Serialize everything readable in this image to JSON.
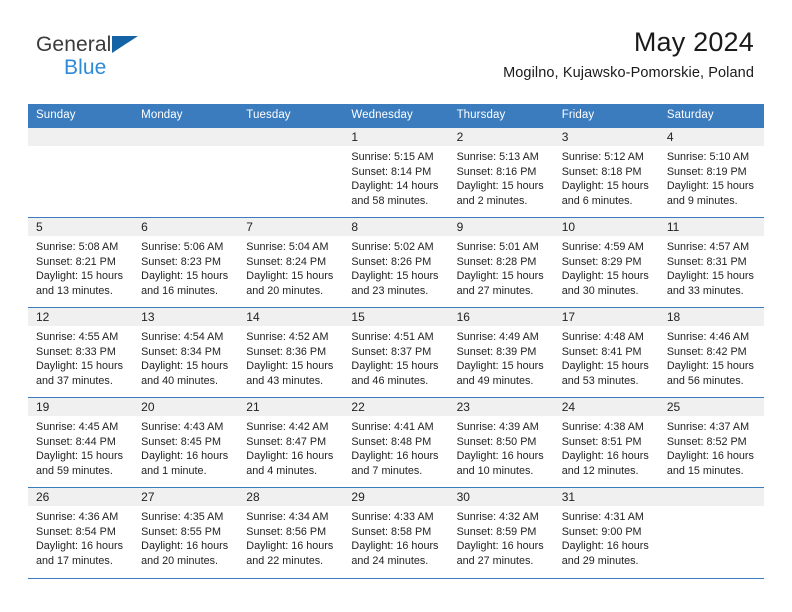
{
  "brand": {
    "name_line1": "General",
    "name_line2": "Blue",
    "accent_color": "#2e8ad8",
    "logo_mark_color": "#1464a5"
  },
  "header": {
    "month_title": "May 2024",
    "location": "Mogilno, Kujawsko-Pomorskie, Poland"
  },
  "calendar": {
    "header_bg": "#3a7cbe",
    "header_text_color": "#ffffff",
    "daynum_band_bg": "#f0f0f0",
    "weekday_headers": [
      "Sunday",
      "Monday",
      "Tuesday",
      "Wednesday",
      "Thursday",
      "Friday",
      "Saturday"
    ],
    "weeks": [
      [
        {
          "day": "",
          "empty": true
        },
        {
          "day": "",
          "empty": true
        },
        {
          "day": "",
          "empty": true
        },
        {
          "day": "1",
          "sunrise": "Sunrise: 5:15 AM",
          "sunset": "Sunset: 8:14 PM",
          "daylight_line1": "Daylight: 14 hours",
          "daylight_line2": "and 58 minutes."
        },
        {
          "day": "2",
          "sunrise": "Sunrise: 5:13 AM",
          "sunset": "Sunset: 8:16 PM",
          "daylight_line1": "Daylight: 15 hours",
          "daylight_line2": "and 2 minutes."
        },
        {
          "day": "3",
          "sunrise": "Sunrise: 5:12 AM",
          "sunset": "Sunset: 8:18 PM",
          "daylight_line1": "Daylight: 15 hours",
          "daylight_line2": "and 6 minutes."
        },
        {
          "day": "4",
          "sunrise": "Sunrise: 5:10 AM",
          "sunset": "Sunset: 8:19 PM",
          "daylight_line1": "Daylight: 15 hours",
          "daylight_line2": "and 9 minutes."
        }
      ],
      [
        {
          "day": "5",
          "sunrise": "Sunrise: 5:08 AM",
          "sunset": "Sunset: 8:21 PM",
          "daylight_line1": "Daylight: 15 hours",
          "daylight_line2": "and 13 minutes."
        },
        {
          "day": "6",
          "sunrise": "Sunrise: 5:06 AM",
          "sunset": "Sunset: 8:23 PM",
          "daylight_line1": "Daylight: 15 hours",
          "daylight_line2": "and 16 minutes."
        },
        {
          "day": "7",
          "sunrise": "Sunrise: 5:04 AM",
          "sunset": "Sunset: 8:24 PM",
          "daylight_line1": "Daylight: 15 hours",
          "daylight_line2": "and 20 minutes."
        },
        {
          "day": "8",
          "sunrise": "Sunrise: 5:02 AM",
          "sunset": "Sunset: 8:26 PM",
          "daylight_line1": "Daylight: 15 hours",
          "daylight_line2": "and 23 minutes."
        },
        {
          "day": "9",
          "sunrise": "Sunrise: 5:01 AM",
          "sunset": "Sunset: 8:28 PM",
          "daylight_line1": "Daylight: 15 hours",
          "daylight_line2": "and 27 minutes."
        },
        {
          "day": "10",
          "sunrise": "Sunrise: 4:59 AM",
          "sunset": "Sunset: 8:29 PM",
          "daylight_line1": "Daylight: 15 hours",
          "daylight_line2": "and 30 minutes."
        },
        {
          "day": "11",
          "sunrise": "Sunrise: 4:57 AM",
          "sunset": "Sunset: 8:31 PM",
          "daylight_line1": "Daylight: 15 hours",
          "daylight_line2": "and 33 minutes."
        }
      ],
      [
        {
          "day": "12",
          "sunrise": "Sunrise: 4:55 AM",
          "sunset": "Sunset: 8:33 PM",
          "daylight_line1": "Daylight: 15 hours",
          "daylight_line2": "and 37 minutes."
        },
        {
          "day": "13",
          "sunrise": "Sunrise: 4:54 AM",
          "sunset": "Sunset: 8:34 PM",
          "daylight_line1": "Daylight: 15 hours",
          "daylight_line2": "and 40 minutes."
        },
        {
          "day": "14",
          "sunrise": "Sunrise: 4:52 AM",
          "sunset": "Sunset: 8:36 PM",
          "daylight_line1": "Daylight: 15 hours",
          "daylight_line2": "and 43 minutes."
        },
        {
          "day": "15",
          "sunrise": "Sunrise: 4:51 AM",
          "sunset": "Sunset: 8:37 PM",
          "daylight_line1": "Daylight: 15 hours",
          "daylight_line2": "and 46 minutes."
        },
        {
          "day": "16",
          "sunrise": "Sunrise: 4:49 AM",
          "sunset": "Sunset: 8:39 PM",
          "daylight_line1": "Daylight: 15 hours",
          "daylight_line2": "and 49 minutes."
        },
        {
          "day": "17",
          "sunrise": "Sunrise: 4:48 AM",
          "sunset": "Sunset: 8:41 PM",
          "daylight_line1": "Daylight: 15 hours",
          "daylight_line2": "and 53 minutes."
        },
        {
          "day": "18",
          "sunrise": "Sunrise: 4:46 AM",
          "sunset": "Sunset: 8:42 PM",
          "daylight_line1": "Daylight: 15 hours",
          "daylight_line2": "and 56 minutes."
        }
      ],
      [
        {
          "day": "19",
          "sunrise": "Sunrise: 4:45 AM",
          "sunset": "Sunset: 8:44 PM",
          "daylight_line1": "Daylight: 15 hours",
          "daylight_line2": "and 59 minutes."
        },
        {
          "day": "20",
          "sunrise": "Sunrise: 4:43 AM",
          "sunset": "Sunset: 8:45 PM",
          "daylight_line1": "Daylight: 16 hours",
          "daylight_line2": "and 1 minute."
        },
        {
          "day": "21",
          "sunrise": "Sunrise: 4:42 AM",
          "sunset": "Sunset: 8:47 PM",
          "daylight_line1": "Daylight: 16 hours",
          "daylight_line2": "and 4 minutes."
        },
        {
          "day": "22",
          "sunrise": "Sunrise: 4:41 AM",
          "sunset": "Sunset: 8:48 PM",
          "daylight_line1": "Daylight: 16 hours",
          "daylight_line2": "and 7 minutes."
        },
        {
          "day": "23",
          "sunrise": "Sunrise: 4:39 AM",
          "sunset": "Sunset: 8:50 PM",
          "daylight_line1": "Daylight: 16 hours",
          "daylight_line2": "and 10 minutes."
        },
        {
          "day": "24",
          "sunrise": "Sunrise: 4:38 AM",
          "sunset": "Sunset: 8:51 PM",
          "daylight_line1": "Daylight: 16 hours",
          "daylight_line2": "and 12 minutes."
        },
        {
          "day": "25",
          "sunrise": "Sunrise: 4:37 AM",
          "sunset": "Sunset: 8:52 PM",
          "daylight_line1": "Daylight: 16 hours",
          "daylight_line2": "and 15 minutes."
        }
      ],
      [
        {
          "day": "26",
          "sunrise": "Sunrise: 4:36 AM",
          "sunset": "Sunset: 8:54 PM",
          "daylight_line1": "Daylight: 16 hours",
          "daylight_line2": "and 17 minutes."
        },
        {
          "day": "27",
          "sunrise": "Sunrise: 4:35 AM",
          "sunset": "Sunset: 8:55 PM",
          "daylight_line1": "Daylight: 16 hours",
          "daylight_line2": "and 20 minutes."
        },
        {
          "day": "28",
          "sunrise": "Sunrise: 4:34 AM",
          "sunset": "Sunset: 8:56 PM",
          "daylight_line1": "Daylight: 16 hours",
          "daylight_line2": "and 22 minutes."
        },
        {
          "day": "29",
          "sunrise": "Sunrise: 4:33 AM",
          "sunset": "Sunset: 8:58 PM",
          "daylight_line1": "Daylight: 16 hours",
          "daylight_line2": "and 24 minutes."
        },
        {
          "day": "30",
          "sunrise": "Sunrise: 4:32 AM",
          "sunset": "Sunset: 8:59 PM",
          "daylight_line1": "Daylight: 16 hours",
          "daylight_line2": "and 27 minutes."
        },
        {
          "day": "31",
          "sunrise": "Sunrise: 4:31 AM",
          "sunset": "Sunset: 9:00 PM",
          "daylight_line1": "Daylight: 16 hours",
          "daylight_line2": "and 29 minutes."
        },
        {
          "day": "",
          "empty": true
        }
      ]
    ]
  }
}
